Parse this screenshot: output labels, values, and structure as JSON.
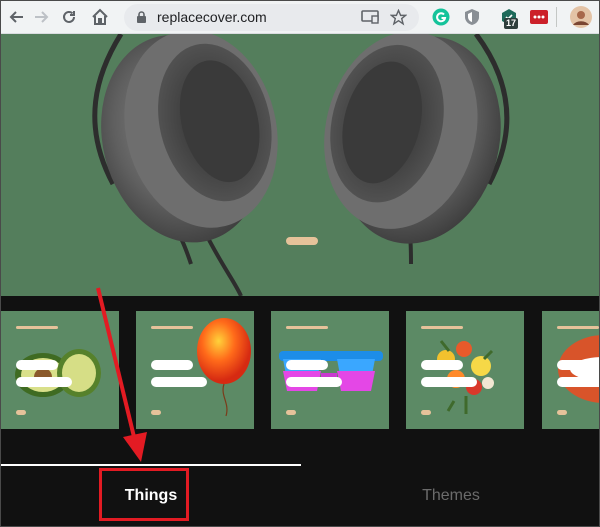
{
  "browser": {
    "url": "replacecover.com",
    "extension_badge": "17",
    "icons": [
      "back-arrow-icon",
      "forward-arrow-icon",
      "reload-icon",
      "home-icon",
      "lock-icon",
      "cast-icon",
      "star-icon",
      "grammarly-icon",
      "shield-icon",
      "extension-icon",
      "lastpass-icon",
      "profile-avatar"
    ]
  },
  "tabs": [
    {
      "label": "Things",
      "active": true
    },
    {
      "label": "Themes",
      "active": false
    }
  ],
  "cards": [
    {
      "name": "avocado"
    },
    {
      "name": "balloon"
    },
    {
      "name": "sunglasses"
    },
    {
      "name": "flowers"
    },
    {
      "name": "lips"
    }
  ],
  "colors": {
    "hero_bg": "#547e5c",
    "card_bg": "#5c8a65",
    "accent": "#e6c29a",
    "annotation": "#e31b23"
  }
}
